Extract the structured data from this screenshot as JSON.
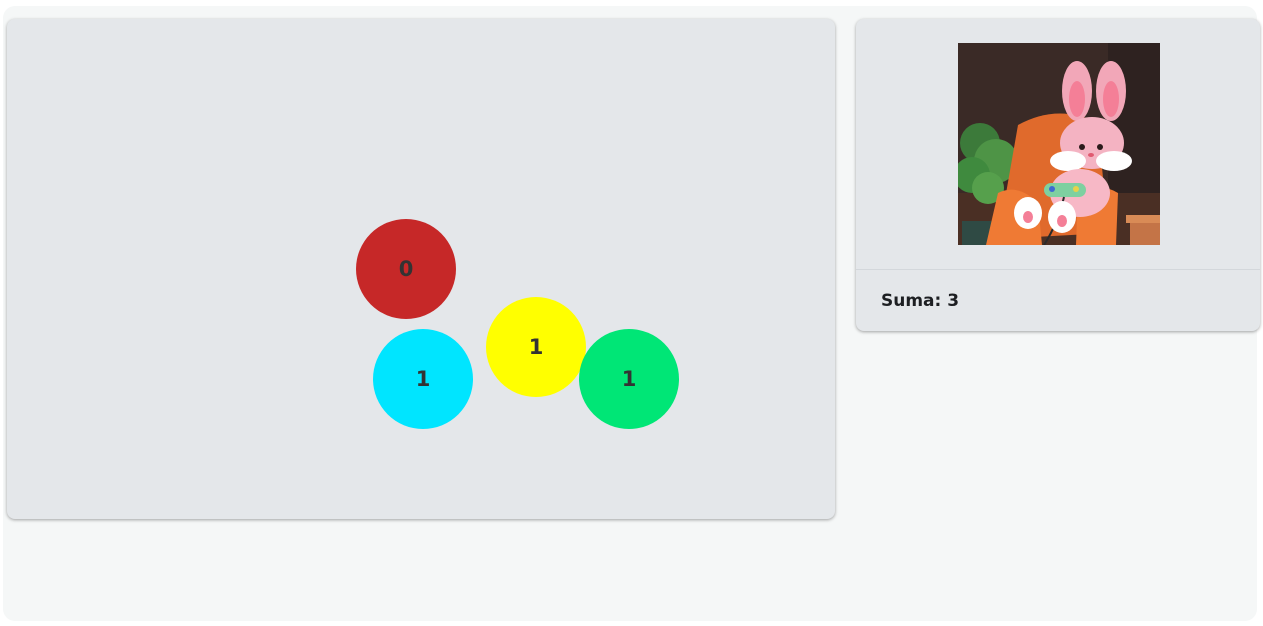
{
  "board": {
    "balls": [
      {
        "value": "0",
        "color": "#c62828"
      },
      {
        "value": "1",
        "color": "#00e5ff"
      },
      {
        "value": "1",
        "color": "#ffff00"
      },
      {
        "value": "1",
        "color": "#00e676"
      }
    ]
  },
  "sidebar": {
    "avatar": "bunny-gamer-image",
    "sum_label": "Suma:",
    "sum_value": "3"
  }
}
